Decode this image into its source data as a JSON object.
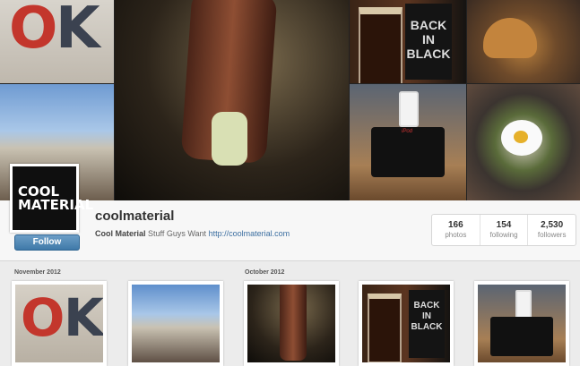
{
  "avatar": {
    "line1": "COOL",
    "line2": "MATERIAL"
  },
  "banner": {
    "ok_letters": [
      "O",
      "K"
    ],
    "beer_can_line1": "BACK IN",
    "beer_can_line2": "BLACK",
    "dock_brand": "iPod"
  },
  "profile": {
    "username": "coolmaterial",
    "follow_label": "Follow",
    "bio_name": "Cool Material",
    "bio_text": "Stuff Guys Want",
    "bio_link": "http://coolmaterial.com"
  },
  "stats": [
    {
      "value": "166",
      "label": "photos"
    },
    {
      "value": "154",
      "label": "following"
    },
    {
      "value": "2,530",
      "label": "followers"
    }
  ],
  "sections": [
    {
      "label": "November 2012"
    },
    {
      "label": "October 2012"
    }
  ]
}
